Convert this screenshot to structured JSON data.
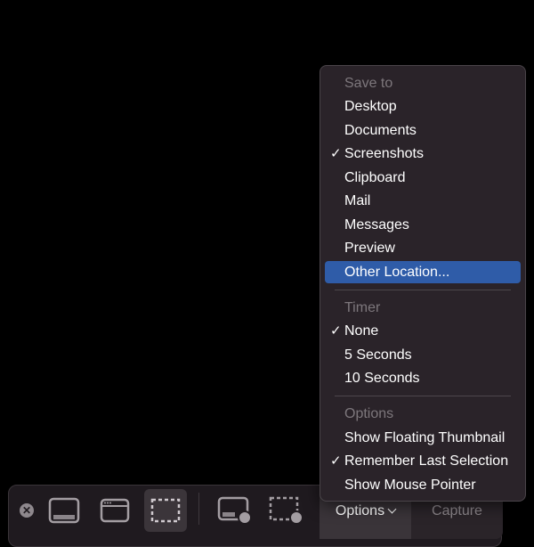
{
  "toolbar": {
    "close_icon": "✕",
    "buttons": [
      {
        "name": "capture-entire-screen",
        "icon": "screen-icon",
        "active": false
      },
      {
        "name": "capture-window",
        "icon": "window-icon",
        "active": false
      },
      {
        "name": "capture-selection",
        "icon": "selection-icon",
        "active": true
      },
      {
        "name": "record-entire-screen",
        "icon": "screen-record-icon",
        "active": false
      },
      {
        "name": "record-selection",
        "icon": "selection-record-icon",
        "active": false
      }
    ],
    "options_label": "Options",
    "capture_label": "Capture"
  },
  "menu": {
    "sections": [
      {
        "header": "Save to",
        "items": [
          {
            "label": "Desktop",
            "checked": false
          },
          {
            "label": "Documents",
            "checked": false
          },
          {
            "label": "Screenshots",
            "checked": true
          },
          {
            "label": "Clipboard",
            "checked": false
          },
          {
            "label": "Mail",
            "checked": false
          },
          {
            "label": "Messages",
            "checked": false
          },
          {
            "label": "Preview",
            "checked": false
          },
          {
            "label": "Other Location...",
            "checked": false,
            "highlighted": true
          }
        ]
      },
      {
        "header": "Timer",
        "items": [
          {
            "label": "None",
            "checked": true
          },
          {
            "label": "5 Seconds",
            "checked": false
          },
          {
            "label": "10 Seconds",
            "checked": false
          }
        ]
      },
      {
        "header": "Options",
        "items": [
          {
            "label": "Show Floating Thumbnail",
            "checked": false
          },
          {
            "label": "Remember Last Selection",
            "checked": true
          },
          {
            "label": "Show Mouse Pointer",
            "checked": false
          }
        ]
      }
    ],
    "check_glyph": "✓"
  }
}
